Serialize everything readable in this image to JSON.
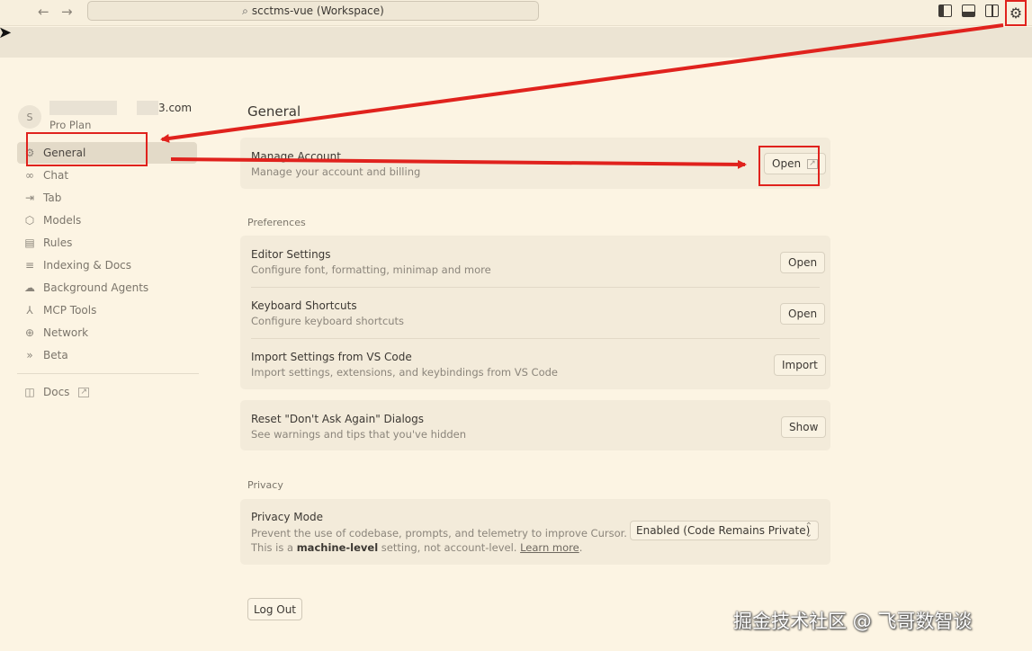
{
  "titlebar": {
    "back_icon": "←",
    "forward_icon": "→",
    "search_text": "scctms-vue (Workspace)"
  },
  "account": {
    "avatar_letter": "S",
    "email_visible": "3.com",
    "plan": "Pro Plan"
  },
  "sidebar": {
    "items": [
      {
        "label": "General",
        "icon": "gear-icon"
      },
      {
        "label": "Chat",
        "icon": "infinity-icon"
      },
      {
        "label": "Tab",
        "icon": "tab-arrow-icon"
      },
      {
        "label": "Models",
        "icon": "cube-icon"
      },
      {
        "label": "Rules",
        "icon": "document-icon"
      },
      {
        "label": "Indexing & Docs",
        "icon": "database-icon"
      },
      {
        "label": "Background Agents",
        "icon": "cloud-icon"
      },
      {
        "label": "MCP Tools",
        "icon": "network-nodes-icon"
      },
      {
        "label": "Network",
        "icon": "globe-icon"
      },
      {
        "label": "Beta",
        "icon": "double-chevron-icon"
      }
    ],
    "docs_label": "Docs"
  },
  "main": {
    "title": "General",
    "manage_account": {
      "title": "Manage Account",
      "desc": "Manage your account and billing",
      "button": "Open"
    },
    "preferences_label": "Preferences",
    "preferences": [
      {
        "title": "Editor Settings",
        "desc": "Configure font, formatting, minimap and more",
        "button": "Open"
      },
      {
        "title": "Keyboard Shortcuts",
        "desc": "Configure keyboard shortcuts",
        "button": "Open"
      },
      {
        "title": "Import Settings from VS Code",
        "desc": "Import settings, extensions, and keybindings from VS Code",
        "button": "Import"
      }
    ],
    "reset_dialogs": {
      "title": "Reset \"Don't Ask Again\" Dialogs",
      "desc": "See warnings and tips that you've hidden",
      "button": "Show"
    },
    "privacy_label": "Privacy",
    "privacy": {
      "title": "Privacy Mode",
      "desc_line1": "Prevent the use of codebase, prompts, and telemetry to improve Cursor.",
      "desc_prefix": "This is a ",
      "desc_bold": "machine-level",
      "desc_middle": " setting, not account-level. ",
      "desc_link": "Learn more",
      "desc_suffix": ".",
      "select_value": "Enabled (Code Remains Private)"
    },
    "logout_label": "Log Out"
  },
  "annotation_color": "#e0221d",
  "watermark": "掘金技术社区 @ 飞哥数智谈"
}
